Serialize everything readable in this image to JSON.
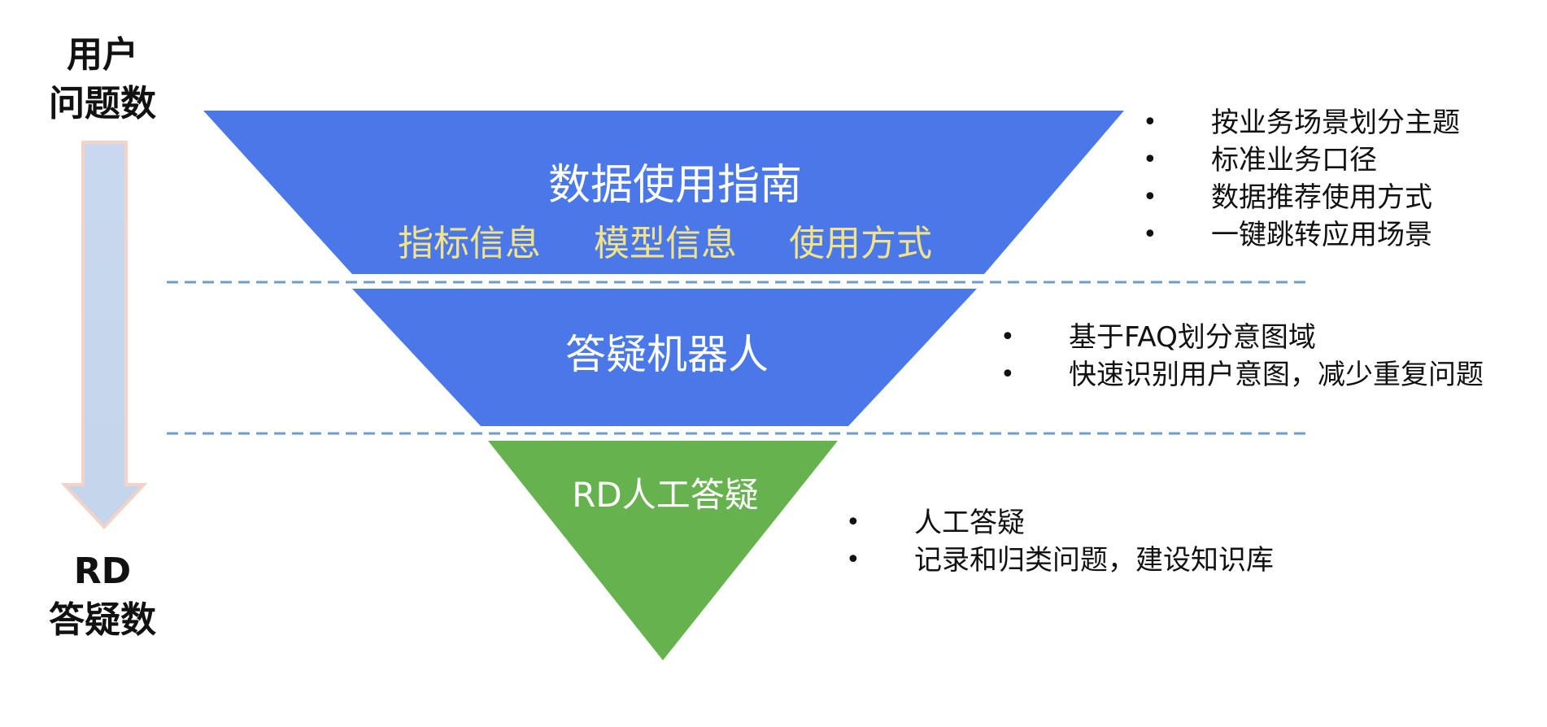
{
  "axis": {
    "top_label_line1": "用户",
    "top_label_line2": "问题数",
    "bottom_label_line1": "RD",
    "bottom_label_line2": "答疑数"
  },
  "tiers": [
    {
      "title": "数据使用指南",
      "subitems": [
        "指标信息",
        "模型信息",
        "使用方式"
      ],
      "bullets": [
        "按业务场景划分主题",
        "标准业务口径",
        "数据推荐使用方式",
        "一键跳转应用场景"
      ],
      "color": "#4a78e8"
    },
    {
      "title": "答疑机器人",
      "subitems": [],
      "bullets": [
        "基于FAQ划分意图域",
        "快速识别用户意图，减少重复问题"
      ],
      "color": "#4a78e8"
    },
    {
      "title": "RD人工答疑",
      "subitems": [],
      "bullets": [
        "人工答疑",
        "记录和归类问题，建设知识库"
      ],
      "color": "#66b24e"
    }
  ],
  "colors": {
    "subitem_text": "#f2e38a",
    "arrow_fill": "#c9d8ee",
    "arrow_stroke": "#f3d3c7",
    "divider": "#6f9ccf"
  }
}
